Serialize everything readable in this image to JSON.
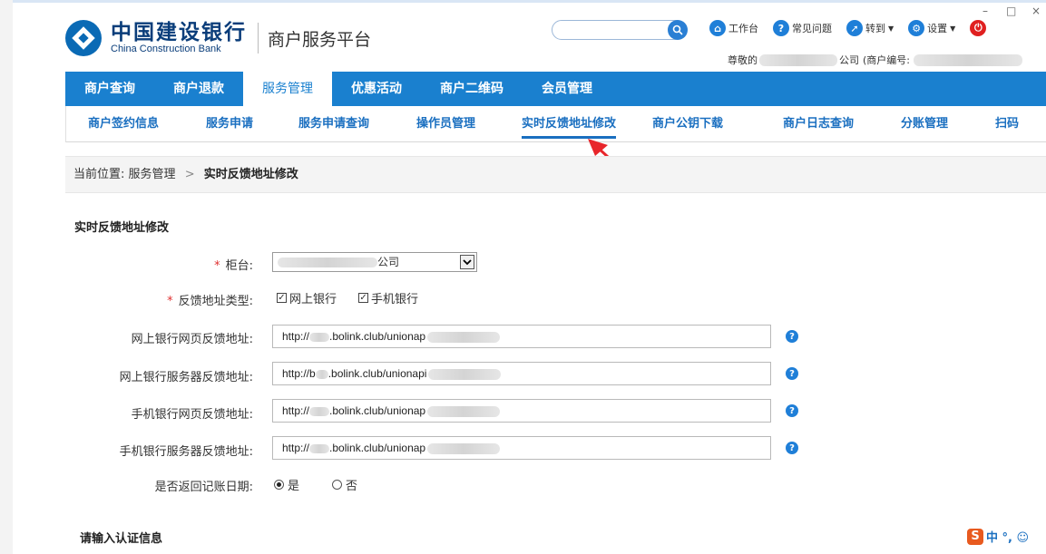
{
  "window": {
    "minimize": "–",
    "maximize": "□",
    "close": "×"
  },
  "header": {
    "bank_name_cn": "中国建设银行",
    "bank_name_en": "China Construction Bank",
    "platform_title": "商户服务平台",
    "search_placeholder": "",
    "top_links": [
      {
        "label": "工作台",
        "icon": "home-icon"
      },
      {
        "label": "常见问题",
        "icon": "question-icon"
      },
      {
        "label": "转到",
        "icon": "goto-icon",
        "caret": "▼"
      },
      {
        "label": "设置",
        "icon": "gear-icon",
        "caret": "▼"
      }
    ],
    "welcome_prefix": "尊敬的",
    "welcome_company_suffix": "公司",
    "merchant_no_label": "(商户编号:"
  },
  "nav_primary": [
    "商户查询",
    "商户退款",
    "服务管理",
    "优惠活动",
    "商户二维码",
    "会员管理"
  ],
  "nav_secondary": [
    "商户签约信息",
    "服务申请",
    "服务申请查询",
    "操作员管理",
    "实时反馈地址修改",
    "商户公钥下载",
    "商户日志查询",
    "分账管理",
    "扫码"
  ],
  "breadcrumb": {
    "prefix": "当前位置:",
    "parent": "服务管理",
    "separator": ">",
    "current": "实时反馈地址修改"
  },
  "form": {
    "title": "实时反馈地址修改",
    "required_mark": "*",
    "counter_label": "柜台:",
    "counter_value_suffix": "公司",
    "feedback_type_label": "反馈地址类型:",
    "feedback_types": [
      {
        "label": "网上银行",
        "checked": true
      },
      {
        "label": "手机银行",
        "checked": true
      }
    ],
    "check_mark": "✓",
    "url_fields": [
      {
        "label": "网上银行网页反馈地址:",
        "value_start": "http://",
        "value_mid": ".bolink.club/unionap"
      },
      {
        "label": "网上银行服务器反馈地址:",
        "value_start": "http://b",
        "value_mid": ".bolink.club/unionapi"
      },
      {
        "label": "手机银行网页反馈地址:",
        "value_start": "http://",
        "value_mid": ".bolink.club/unionap"
      },
      {
        "label": "手机银行服务器反馈地址:",
        "value_start": "http://",
        "value_mid": ".bolink.club/unionap"
      }
    ],
    "help_glyph": "?",
    "return_date_label": "是否返回记账日期:",
    "return_date_options": [
      {
        "label": "是",
        "selected": true
      },
      {
        "label": "否",
        "selected": false
      }
    ],
    "auth_title": "请输入认证信息"
  },
  "ime": {
    "badge": "S",
    "text": "中 °, ☺"
  },
  "colors": {
    "nav_blue": "#1a80cf",
    "link_blue": "#1a6fc0",
    "required_red": "#e03030",
    "arrow_red": "#e8262b"
  }
}
